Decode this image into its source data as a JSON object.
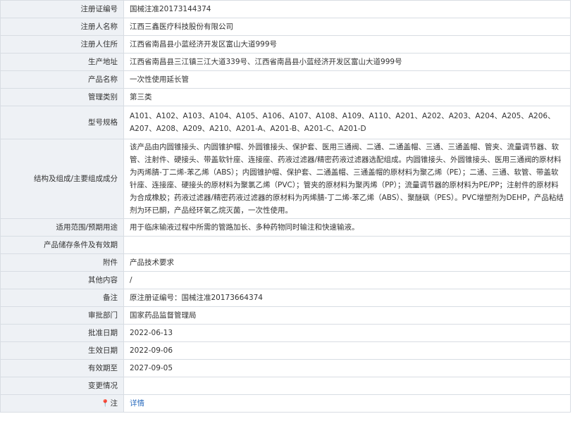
{
  "rows": [
    {
      "label": "注册证编号",
      "value": "国械注准20173144374"
    },
    {
      "label": "注册人名称",
      "value": "江西三鑫医疗科技股份有限公司"
    },
    {
      "label": "注册人住所",
      "value": "江西省南昌县小蓝经济开发区富山大道999号"
    },
    {
      "label": "生产地址",
      "value": "江西省南昌县三江镇三江大道339号、江西省南昌县小蓝经济开发区富山大道999号"
    },
    {
      "label": "产品名称",
      "value": "一次性使用延长管"
    },
    {
      "label": "管理类别",
      "value": "第三类"
    },
    {
      "label": "型号规格",
      "value": "A101、A102、A103、A104、A105、A106、A107、A108、A109、A110、A201、A202、A203、A204、A205、A206、A207、A208、A209、A210、A201-A、A201-B、A201-C、A201-D"
    },
    {
      "label": "结构及组成/主要组成成分",
      "value": "该产品由内圆锥接头、内圆锥护帽、外圆锥接头、保护套、医用三通阀、二通、二通盖帽、三通、三通盖帽、管夹、流量调节器、软管、注射件、硬接头、带盖软针座、连接座、药液过滤器/精密药液过滤器选配组成。内圆锥接头、外圆锥接头、医用三通阀的原材料为丙烯腈-丁二烯-苯乙烯（ABS）；内圆锥护帽、保护套、二通盖帽、三通盖帽的原材料为聚乙烯（PE）；二通、三通、软管、带盖软针座、连接座、硬接头的原材料为聚氯乙烯（PVC）；管夹的原材料为聚丙烯（PP）；流量调节器的原材料为PE/PP；注射件的原材料为合成橡胶；药液过滤器/精密药液过滤器的原材料为丙烯腈-丁二烯-苯乙烯（ABS）、聚醚砜（PES）。PVC增塑剂为DEHP，产品粘结剂为环已酮，产品经环氧乙烷灭菌，一次性使用。"
    },
    {
      "label": "适用范围/预期用途",
      "value": "用于临床输液过程中所需的管路加长、多种药物同时输注和快速输液。"
    },
    {
      "label": "产品储存条件及有效期",
      "value": ""
    },
    {
      "label": "附件",
      "value": "产品技术要求"
    },
    {
      "label": "其他内容",
      "value": "/"
    },
    {
      "label": "备注",
      "value": "原注册证编号：国械注准20173664374"
    },
    {
      "label": "审批部门",
      "value": "国家药品监督管理局"
    },
    {
      "label": "批准日期",
      "value": "2022-06-13"
    },
    {
      "label": "生效日期",
      "value": "2022-09-06"
    },
    {
      "label": "有效期至",
      "value": "2027-09-05"
    },
    {
      "label": "变更情况",
      "value": ""
    }
  ],
  "note": {
    "label": "注",
    "icon": "pin-icon",
    "link_text": "详情"
  },
  "colors": {
    "label_bg": "#eef1f5",
    "border": "#d8dde3",
    "link": "#2f6fbf",
    "text": "#333333"
  }
}
